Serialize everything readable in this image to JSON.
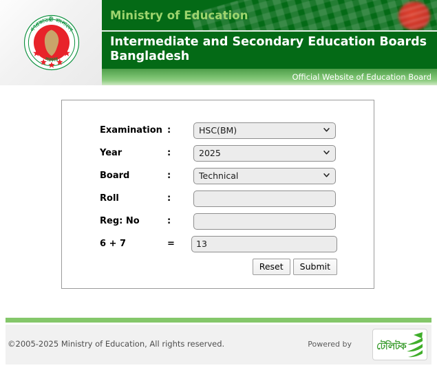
{
  "header": {
    "ministry": "Ministry of Education",
    "board_title": "Intermediate and Secondary Education Boards Bangladesh",
    "official_tagline": "Official Website of Education Board",
    "seal_name": "government-of-bangladesh-seal",
    "colors": {
      "banner_green": "#046a16",
      "ministry_text": "#9ed46d",
      "tagline_bar_green": "#77bf6d"
    }
  },
  "form": {
    "rows": [
      {
        "label": "Examination",
        "separator": ":",
        "type": "select",
        "value": "HSC(BM)"
      },
      {
        "label": "Year",
        "separator": ":",
        "type": "select",
        "value": "2025"
      },
      {
        "label": "Board",
        "separator": ":",
        "type": "select",
        "value": "Technical"
      },
      {
        "label": "Roll",
        "separator": ":",
        "type": "input",
        "value": "",
        "placeholder": ""
      },
      {
        "label": "Reg: No",
        "separator": ":",
        "type": "input",
        "value": "",
        "placeholder": ""
      },
      {
        "label": "6 + 7",
        "separator": "=",
        "type": "input",
        "value": "13",
        "placeholder": ""
      }
    ],
    "buttons": {
      "reset": "Reset",
      "submit": "Submit"
    }
  },
  "footer": {
    "copyright": "©2005-2025 Ministry of Education, All rights reserved.",
    "powered_by": "Powered by",
    "logo_text": "টেলিটক",
    "logo_name": "teletalk-logo",
    "rule_color": "#84c76a"
  }
}
